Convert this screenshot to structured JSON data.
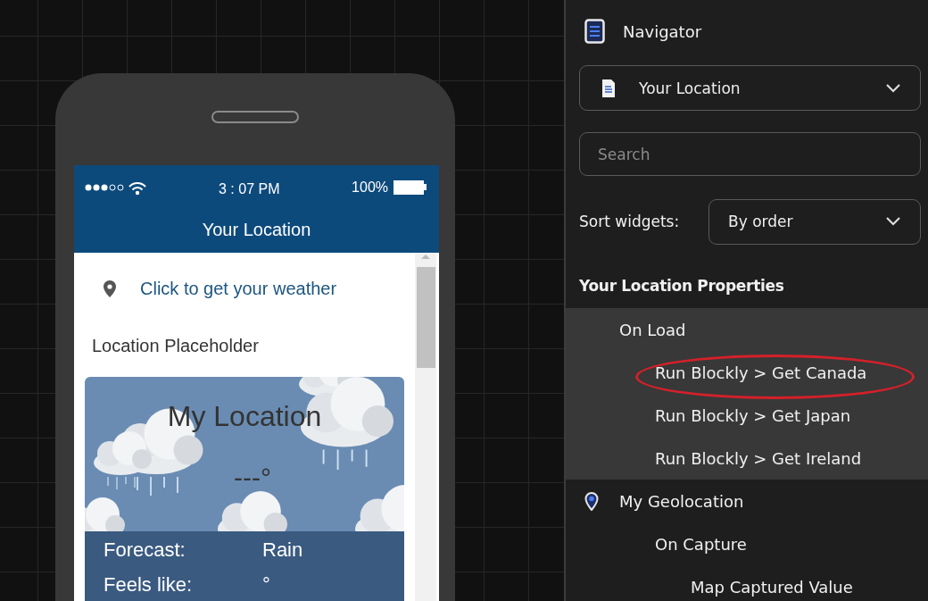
{
  "phone": {
    "status_bar": {
      "time": "3 : 07 PM",
      "battery": "100%"
    },
    "title": "Your Location",
    "link": "Click to get your weather",
    "location_label": "Location Placeholder",
    "weather_card": {
      "heading": "My Location",
      "temperature": "---°",
      "details": [
        {
          "label": "Forecast:",
          "value": "Rain"
        },
        {
          "label": "Feels like:",
          "value": "°"
        }
      ]
    }
  },
  "navigator": {
    "title": "Navigator",
    "page_select": {
      "value": "Your Location"
    },
    "search": {
      "placeholder": "Search"
    },
    "sort": {
      "label": "Sort widgets:",
      "value": "By order"
    },
    "properties_title": "Your Location Properties",
    "tree": [
      {
        "label": "On Load",
        "kind": "event",
        "selected": true,
        "circled": false,
        "children": [
          {
            "label": "Run Blockly > Get Canada",
            "selected": false,
            "circled": true
          },
          {
            "label": "Run Blockly > Get Japan",
            "selected": false,
            "circled": false
          },
          {
            "label": "Run Blockly > Get Ireland",
            "selected": false,
            "circled": false
          }
        ]
      },
      {
        "label": "My Geolocation",
        "kind": "widget",
        "selected": false,
        "circled": false,
        "children": [
          {
            "label": "On Capture",
            "selected": false,
            "circled": false,
            "children": [
              {
                "label": "Map Captured Value",
                "selected": false,
                "circled": false
              }
            ]
          }
        ]
      }
    ]
  }
}
